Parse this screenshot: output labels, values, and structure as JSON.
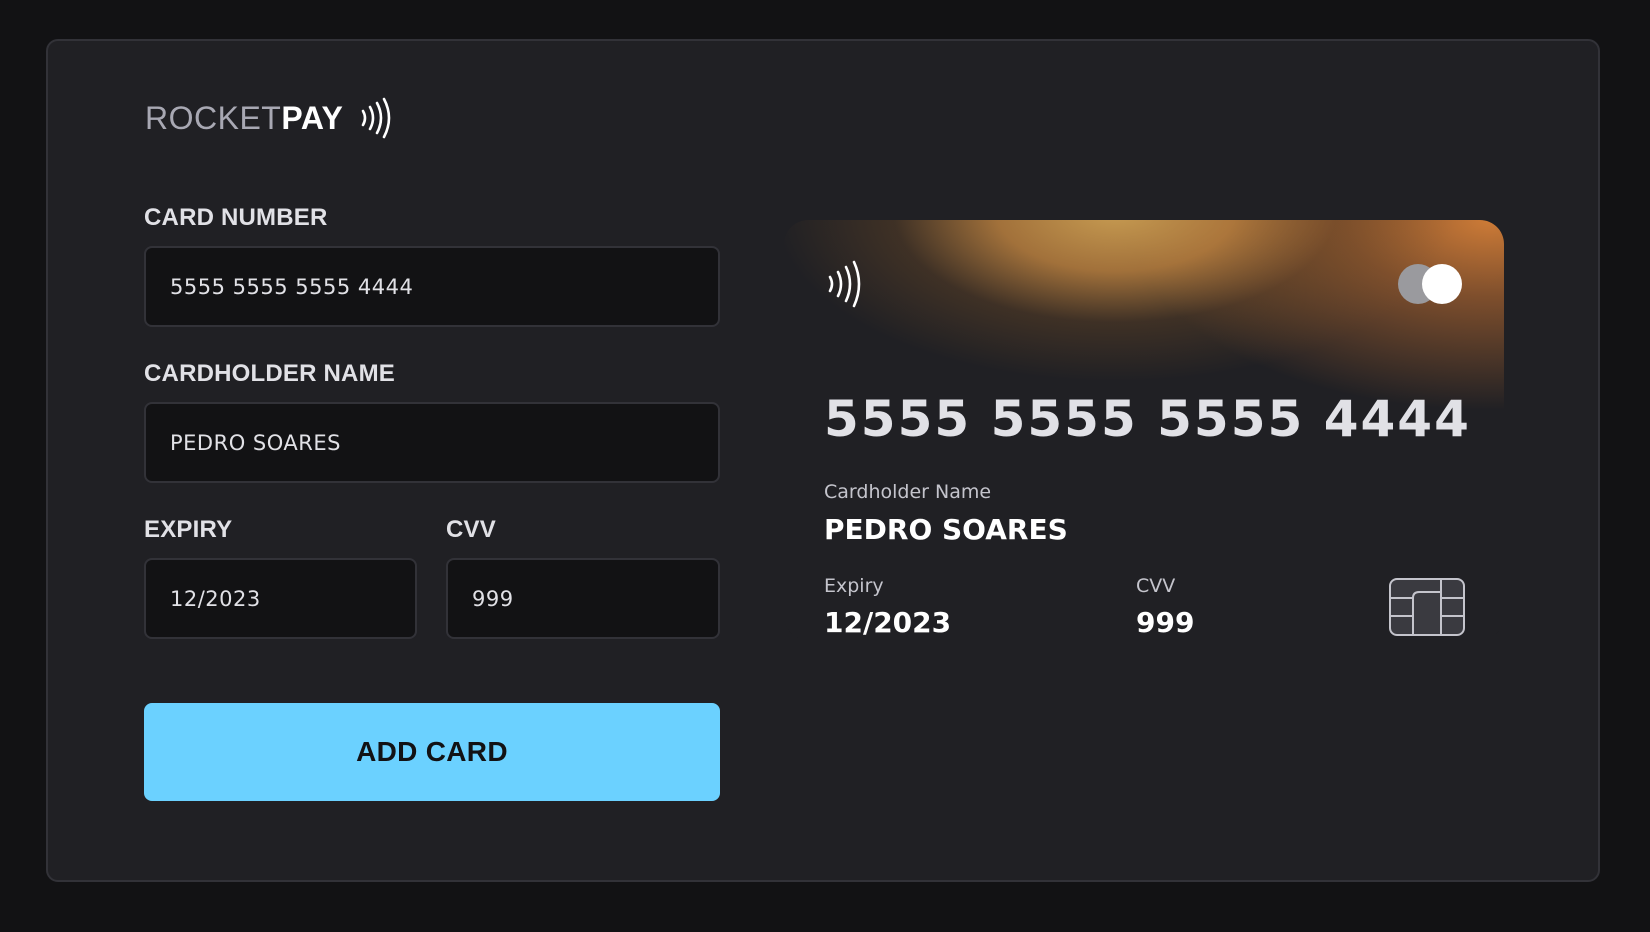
{
  "brand": {
    "name_light": "ROCKET",
    "name_bold": "PAY",
    "icon": "contactless-icon"
  },
  "form": {
    "card_number": {
      "label": "CARD NUMBER",
      "value": "5555 5555 5555 4444"
    },
    "cardholder_name": {
      "label": "CARDHOLDER NAME",
      "value": "PEDRO SOARES"
    },
    "expiry": {
      "label": "EXPIRY",
      "value": "12/2023"
    },
    "cvv": {
      "label": "CVV",
      "value": "999"
    },
    "submit_label": "ADD CARD"
  },
  "card_preview": {
    "number": "5555 5555 5555 4444",
    "cardholder_label": "Cardholder Name",
    "cardholder_value": "PEDRO SOARES",
    "expiry_label": "Expiry",
    "expiry_value": "12/2023",
    "cvv_label": "CVV",
    "cvv_value": "999",
    "network_icon": "mastercard-logo-icon",
    "chip_icon": "chip-icon",
    "contactless_icon": "contactless-icon"
  },
  "colors": {
    "background": "#121214",
    "panel": "#202024",
    "input_background": "#121214",
    "border": "#323238",
    "button": "#6bd1ff",
    "card_gradient_gold": "#d0a254",
    "card_gradient_orange": "#d68038"
  }
}
